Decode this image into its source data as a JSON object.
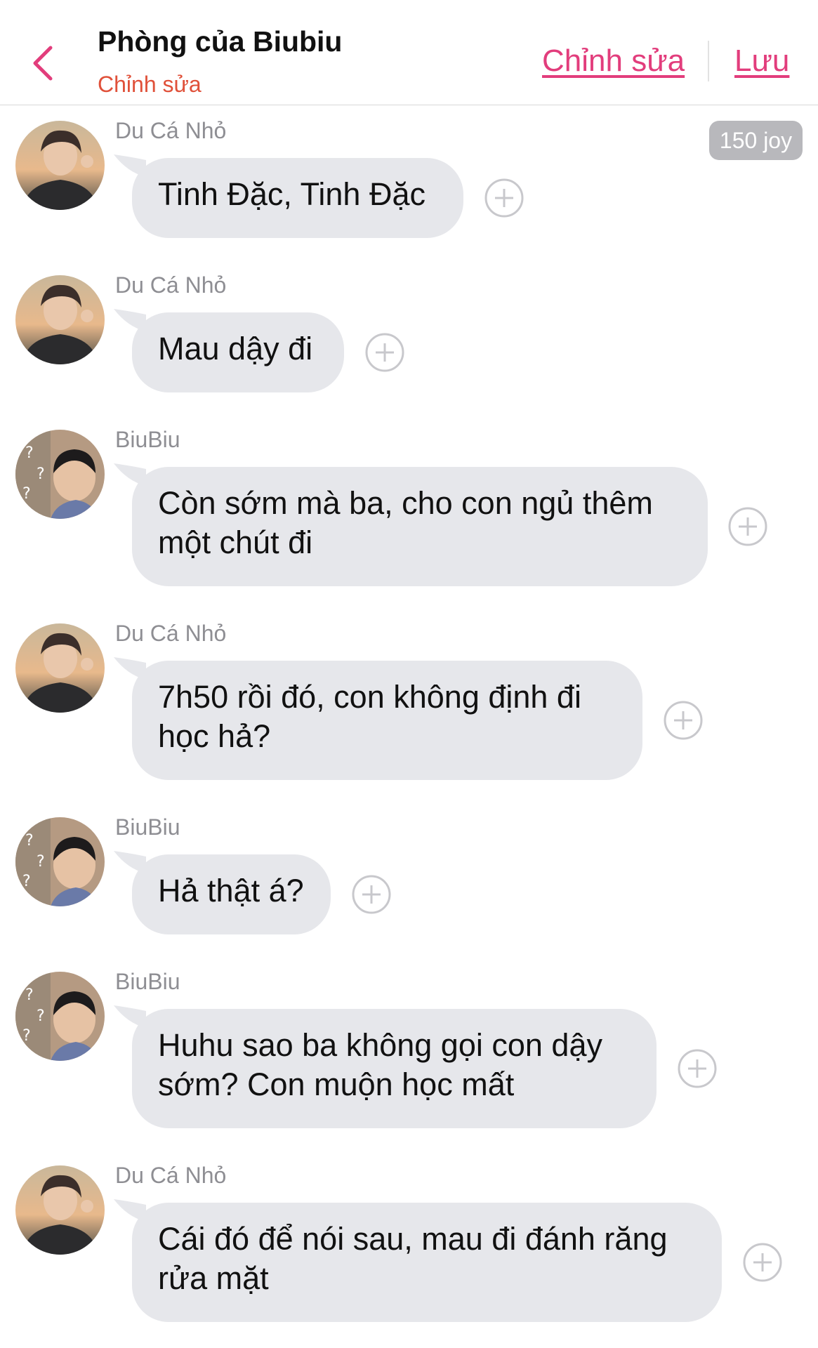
{
  "header": {
    "title": "Phòng của Biubiu",
    "subtitle": "Chỉnh sửa",
    "edit_label": "Chỉnh sửa",
    "save_label": "Lưu"
  },
  "joy_badge": "150 joy",
  "colors": {
    "accent": "#e23d7c",
    "subtitle": "#e0513a",
    "bubble": "#e6e7eb",
    "sender": "#8e8e93"
  },
  "messages": [
    {
      "sender": "Du Cá Nhỏ",
      "avatar": "avatar-du-ca-nho",
      "text": "Tinh Đặc, Tinh Đặc"
    },
    {
      "sender": "Du Cá Nhỏ",
      "avatar": "avatar-du-ca-nho",
      "text": "Mau dậy đi"
    },
    {
      "sender": "BiuBiu",
      "avatar": "avatar-biubiu",
      "text": "Còn sớm mà ba, cho con ngủ thêm\nmột chút đi"
    },
    {
      "sender": "Du Cá Nhỏ",
      "avatar": "avatar-du-ca-nho",
      "text": "7h50 rồi đó, con không định đi\nhọc hả?"
    },
    {
      "sender": "BiuBiu",
      "avatar": "avatar-biubiu",
      "text": "Hả thật á?"
    },
    {
      "sender": "BiuBiu",
      "avatar": "avatar-biubiu",
      "text": "Huhu sao ba không gọi con dậy\nsớm? Con muộn học mất"
    },
    {
      "sender": "Du Cá Nhỏ",
      "avatar": "avatar-du-ca-nho",
      "text": "Cái đó để nói sau, mau đi đánh răng\nrửa mặt"
    }
  ]
}
